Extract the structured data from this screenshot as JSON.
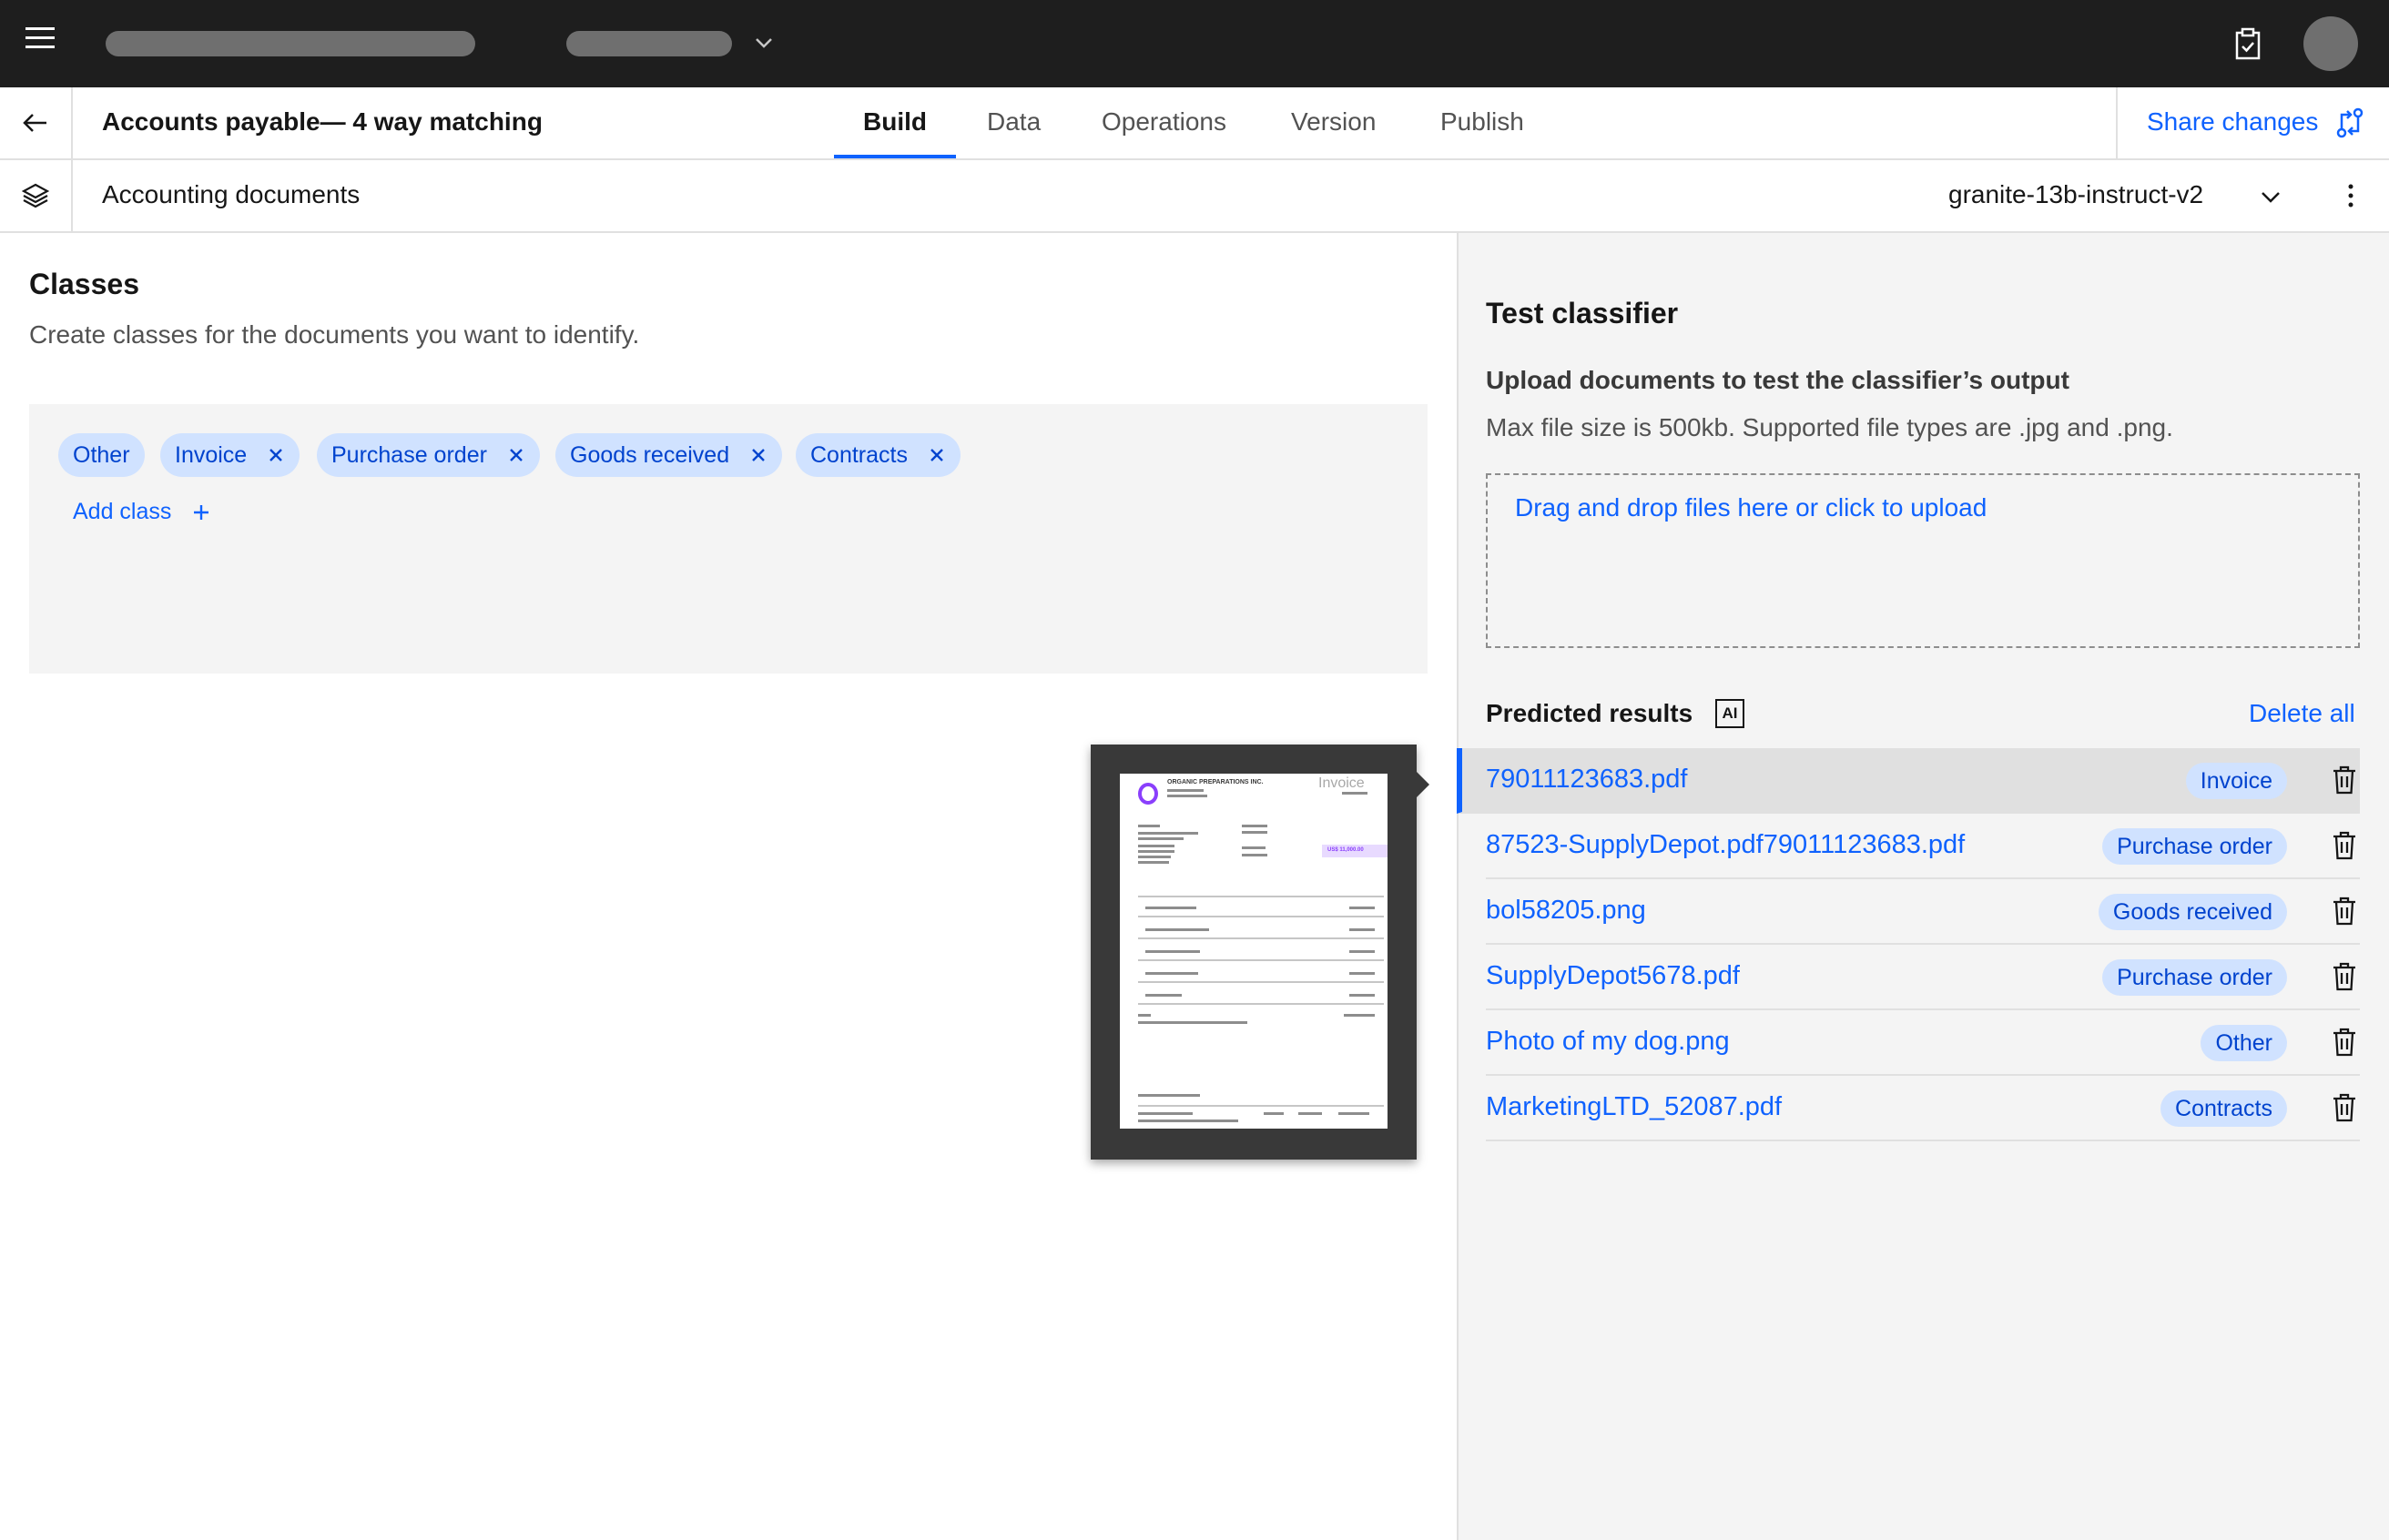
{
  "header": {
    "title": "Accounts payable— 4 way matching",
    "tabs": [
      "Build",
      "Data",
      "Operations",
      "Version",
      "Publish"
    ],
    "active_tab": "Build",
    "share_label": "Share changes"
  },
  "subheader": {
    "project": "Accounting documents",
    "model": "granite-13b-instruct-v2"
  },
  "classes": {
    "title": "Classes",
    "description": "Create classes for the documents you want to identify.",
    "tags": [
      "Other",
      "Invoice",
      "Purchase order",
      "Goods received",
      "Contracts"
    ],
    "add_label": "Add class"
  },
  "preview": {
    "company": "ORGANIC PREPARATIONS INC.",
    "doc_type": "Invoice",
    "amount": "US$ 11,000.00"
  },
  "test": {
    "title": "Test classifier",
    "upload_title": "Upload documents to test the classifier’s output",
    "upload_desc": "Max file size is 500kb. Supported file types are .jpg and .png.",
    "dropzone": "Drag and drop files here or click to upload",
    "results_title": "Predicted results",
    "ai_label": "AI",
    "delete_all": "Delete all",
    "results": [
      {
        "file": "79011123683.pdf",
        "class": "Invoice"
      },
      {
        "file": "87523-SupplyDepot.pdf79011123683.pdf",
        "class": "Purchase order"
      },
      {
        "file": "bol58205.png",
        "class": "Goods received"
      },
      {
        "file": "SupplyDepot5678.pdf",
        "class": "Purchase order"
      },
      {
        "file": "Photo of my dog.png",
        "class": "Other"
      },
      {
        "file": "MarketingLTD_52087.pdf",
        "class": "Contracts"
      }
    ]
  },
  "colors": {
    "accent": "#0f62fe",
    "tag_bg": "#d0e2ff",
    "tag_text": "#0043ce",
    "topbar": "#1e1e1e"
  }
}
